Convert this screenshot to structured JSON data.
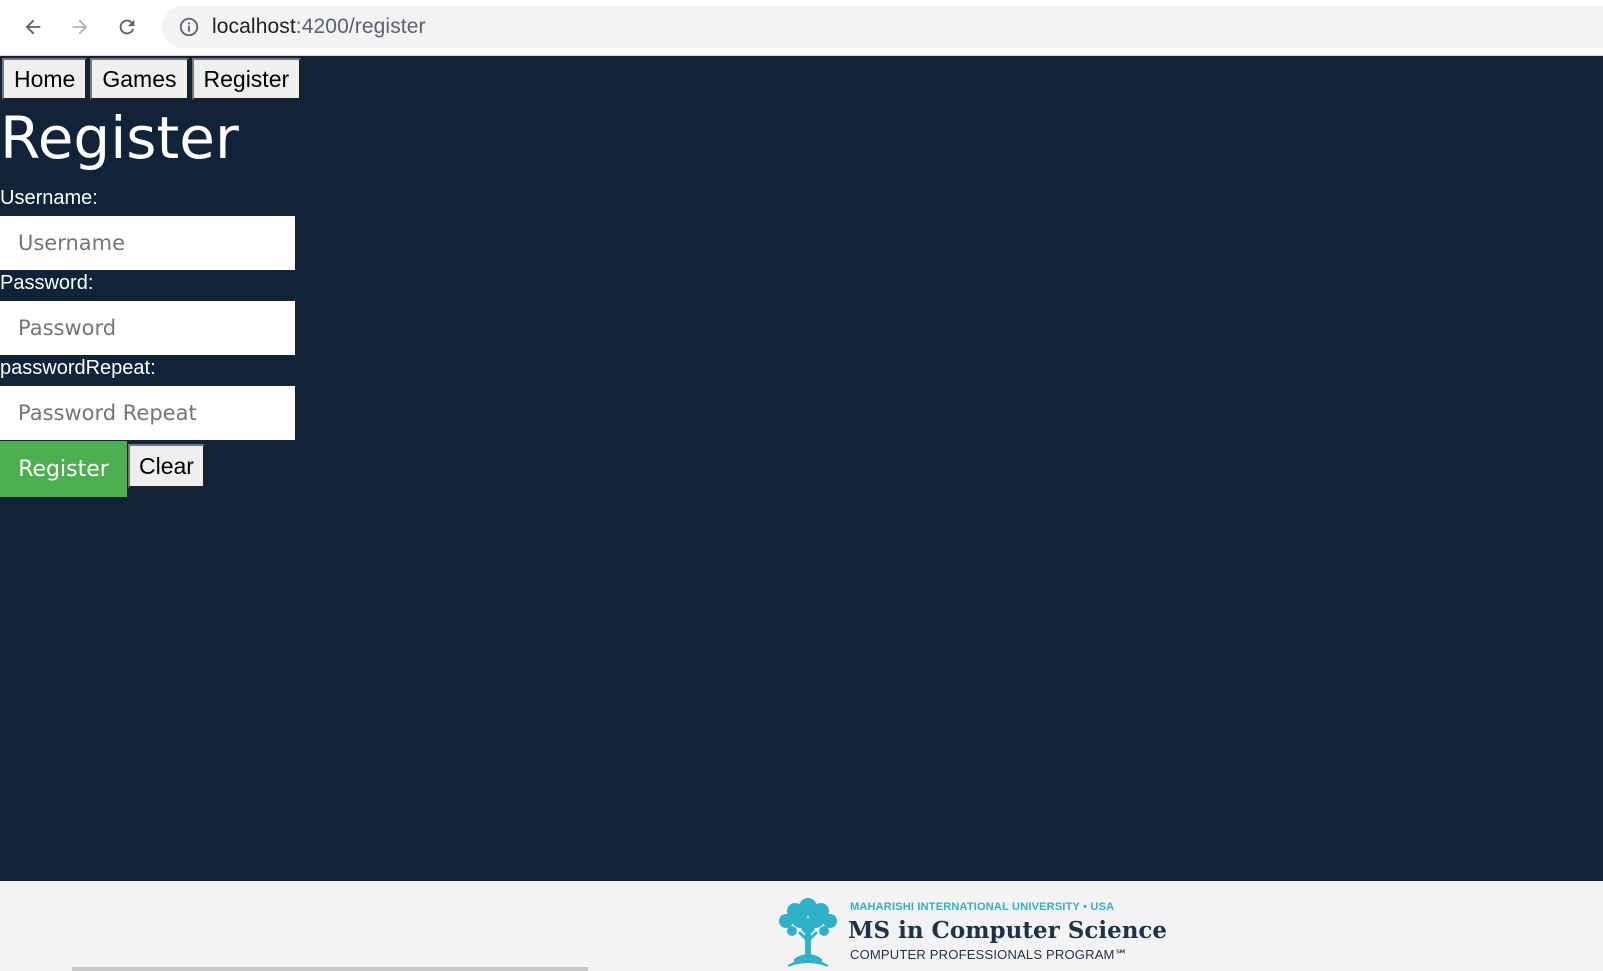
{
  "browser": {
    "url_host": "localhost",
    "url_path": ":4200/register",
    "back_icon": "arrow-left-icon",
    "forward_icon": "arrow-right-icon",
    "reload_icon": "reload-icon",
    "info_icon": "info-icon"
  },
  "nav": {
    "items": [
      {
        "label": "Home"
      },
      {
        "label": "Games"
      },
      {
        "label": "Register"
      }
    ]
  },
  "page": {
    "title": "Register",
    "background": "#102339"
  },
  "form": {
    "username": {
      "label": "Username:",
      "placeholder": "Username",
      "value": ""
    },
    "password": {
      "label": "Password:",
      "placeholder": "Password",
      "value": ""
    },
    "password_repeat": {
      "label": "passwordRepeat:",
      "placeholder": "Password Repeat",
      "value": ""
    },
    "submit_label": "Register",
    "submit_color": "#4caf50",
    "clear_label": "Clear"
  },
  "footer": {
    "logo_icon": "tree-logo-icon",
    "university": "MAHARISHI INTERNATIONAL UNIVERSITY • USA",
    "program": "MS in Computer Science",
    "subtitle": "COMPUTER PROFESSIONALS PROGRAM℠",
    "brand_color": "#2fb2c7"
  }
}
